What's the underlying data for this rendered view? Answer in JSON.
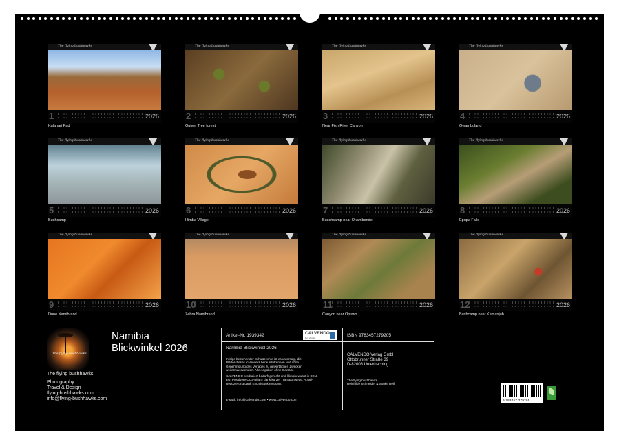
{
  "months": [
    {
      "num": "1",
      "year": "2026",
      "caption": "Kalahari Pad"
    },
    {
      "num": "2",
      "year": "2026",
      "caption": "Quiver Tree forest"
    },
    {
      "num": "3",
      "year": "2026",
      "caption": "Near Fish River Canyon"
    },
    {
      "num": "4",
      "year": "2026",
      "caption": "Owamboland"
    },
    {
      "num": "5",
      "year": "2026",
      "caption": "Bushcamp"
    },
    {
      "num": "6",
      "year": "2026",
      "caption": "Himba Village"
    },
    {
      "num": "7",
      "year": "2026",
      "caption": "Buschcamp near Okambonde"
    },
    {
      "num": "8",
      "year": "2026",
      "caption": "Epupa Falls"
    },
    {
      "num": "9",
      "year": "2026",
      "caption": "Dune Namibrand"
    },
    {
      "num": "10",
      "year": "2026",
      "caption": "Zebra Namibrand"
    },
    {
      "num": "11",
      "year": "2026",
      "caption": "Canyon near Opuwo"
    },
    {
      "num": "12",
      "year": "2026",
      "caption": "Bushcamp near Kamanjab"
    }
  ],
  "brand_small": "The flying bushhawks",
  "logo_text": "The flying bushhawks",
  "calendar_title": [
    "Namibia",
    "Blickwinkel 2026"
  ],
  "author_lines": [
    "The flying bushhawks",
    "",
    "Photography",
    "Travel & Design",
    "flying-bushhawks.com",
    "info@flying-bushhawks.com"
  ],
  "info": {
    "article": "Artikel-Nr. 1939342",
    "title": "Namibia Blickwinkel 2026",
    "legal1": [
      "Infolge bestehender Schutzrechte ist es untersagt, die",
      "Blätter dieses Kalenders herauszutrennen und ohne",
      "Genehmigung des Verlages zu gewerblichen Zwecken",
      "weiterzuverwenden. Alle Angaben ohne Gewähr."
    ],
    "legal2": [
      "CALVENDO produziert bedarfsgerecht und klimabewusst in DE &",
      "EU. Positivere CO2-Bilanz dank kurzer Transportwege. Abfall-",
      "Reduzierung dank Einzelstückfertigung."
    ],
    "email": "E-Mail: info@calvendo.com • www.calvendo.com",
    "isbn": "ISBN 9783457279205",
    "publisher": [
      "CALVENDO Verlag GmbH",
      "Ottobrunner Straße 39",
      "D-82008 Unterhaching"
    ],
    "authors": [
      "The flying bushhawks",
      "Reinhilde Schneider & Sönke Reif"
    ],
    "badge": "CALVENDO",
    "badge_sub": "Der Verlag",
    "barcode_number": "9 783457 279205"
  },
  "colors": {
    "sheet": "#000000",
    "text": "#e6e6e6",
    "border": "#dddddd"
  }
}
